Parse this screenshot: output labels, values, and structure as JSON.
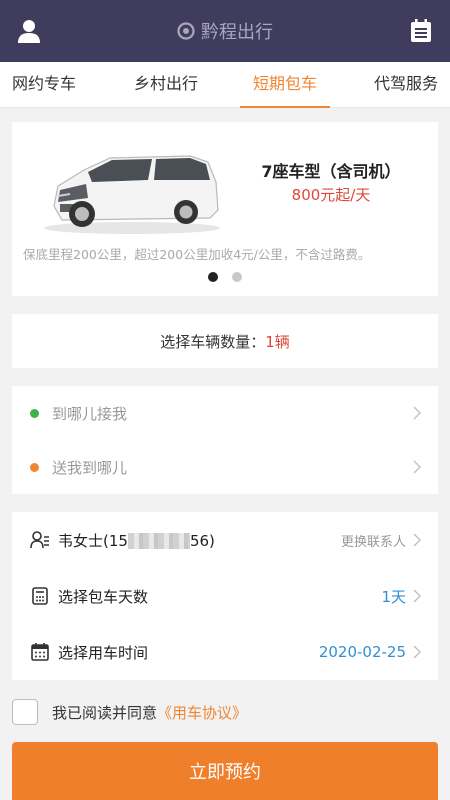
{
  "header": {
    "title": "黔程出行",
    "left_icon": "user-icon",
    "right_icon": "calendar-icon",
    "bg_color": "#403c5e"
  },
  "tabs": [
    {
      "label": "网约专车",
      "active": false
    },
    {
      "label": "乡村出行",
      "active": false
    },
    {
      "label": "短期包车",
      "active": true
    },
    {
      "label": "代驾服务",
      "active": false
    }
  ],
  "car": {
    "title": "7座车型（含司机）",
    "price": "800元起/天",
    "note": "保底里程200公里，超过200公里加收4元/公里，不含过路费。",
    "carousel_pages": 2,
    "carousel_active": 1
  },
  "vehicle_count": {
    "label": "选择车辆数量：",
    "value": "1辆"
  },
  "route": {
    "pickup_placeholder": "到哪儿接我",
    "dropoff_placeholder": "送我到哪儿"
  },
  "contact": {
    "name_prefix": "韦女士(15",
    "name_suffix": "56)",
    "action": "更换联系人"
  },
  "days": {
    "label": "选择包车天数",
    "value": "1天"
  },
  "date": {
    "label": "选择用车时间",
    "value": "2020-02-25"
  },
  "agreement": {
    "text": "我已阅读并同意",
    "link": "《用车协议》",
    "checked": false
  },
  "submit_label": "立即预约",
  "colors": {
    "accent": "#ef7f2b",
    "price": "#e0483a",
    "link_blue": "#2f8fd8",
    "pickup_dot": "#3cb34a",
    "dropoff_dot": "#ef8633"
  }
}
